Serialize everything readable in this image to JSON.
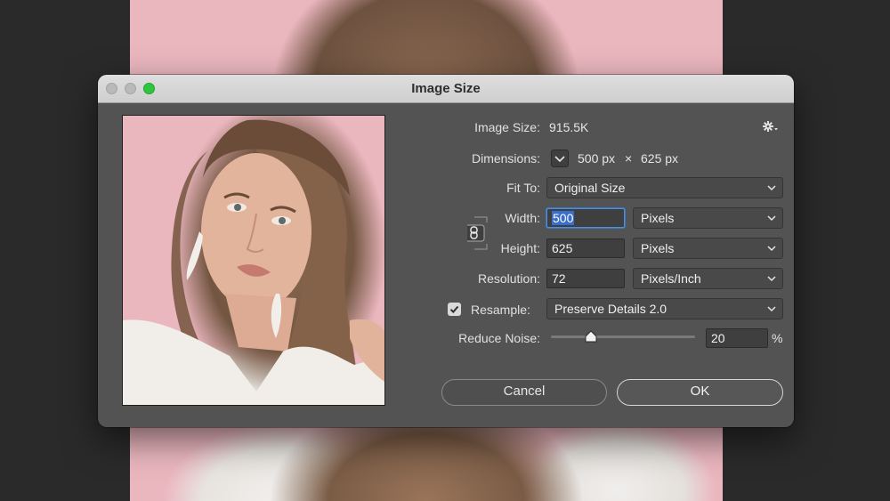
{
  "window": {
    "title": "Image Size"
  },
  "info": {
    "image_size_label": "Image Size:",
    "image_size_value": "915.5K",
    "dimensions_label": "Dimensions:",
    "dimensions_width": "500 px",
    "dimensions_sep": "×",
    "dimensions_height": "625 px"
  },
  "fit_to": {
    "label": "Fit To:",
    "value": "Original Size"
  },
  "width": {
    "label": "Width:",
    "value": "500",
    "unit": "Pixels"
  },
  "height": {
    "label": "Height:",
    "value": "625",
    "unit": "Pixels"
  },
  "resolution": {
    "label": "Resolution:",
    "value": "72",
    "unit": "Pixels/Inch"
  },
  "resample": {
    "label": "Resample:",
    "checked": true,
    "value": "Preserve Details 2.0"
  },
  "reduce_noise": {
    "label": "Reduce Noise:",
    "value": "20",
    "unit": "%",
    "level_percent": 20
  },
  "buttons": {
    "cancel": "Cancel",
    "ok": "OK"
  },
  "icons": {
    "gear": "gear-icon",
    "link": "link-chain-icon",
    "check": "checkmark-icon",
    "chevron": "chevron-down-icon"
  },
  "colors": {
    "dialog_bg": "#535353",
    "titlebar": "#d6d6d6",
    "zoom_button": "#2fc53e",
    "focus_ring": "#4d8fd9",
    "canvas_pink": "#ebb7bf"
  }
}
